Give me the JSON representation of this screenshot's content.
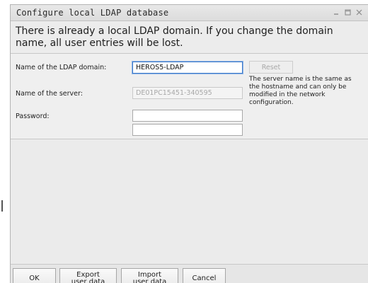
{
  "window": {
    "title": "Configure local LDAP database"
  },
  "message": "There is already a local LDAP domain. If you change the domain name, all user entries will be lost.",
  "form": {
    "domain_label": "Name of the LDAP domain:",
    "domain_value": "HEROS5-LDAP",
    "server_label": "Name of the server:",
    "server_value": "DE01PC15451-340595",
    "password_label": "Password:",
    "password_value": "",
    "password_confirm_value": "",
    "reset_label": "Reset",
    "hint": "The server name is the same as the hostname and can only be modified in the network configuration."
  },
  "buttons": {
    "ok": "OK",
    "export": "Export\nuser data",
    "import": "Import\nuser data",
    "cancel": "Cancel"
  },
  "icons": {
    "minimize": "minimize-icon",
    "maximize": "maximize-icon",
    "close": "close-icon"
  }
}
